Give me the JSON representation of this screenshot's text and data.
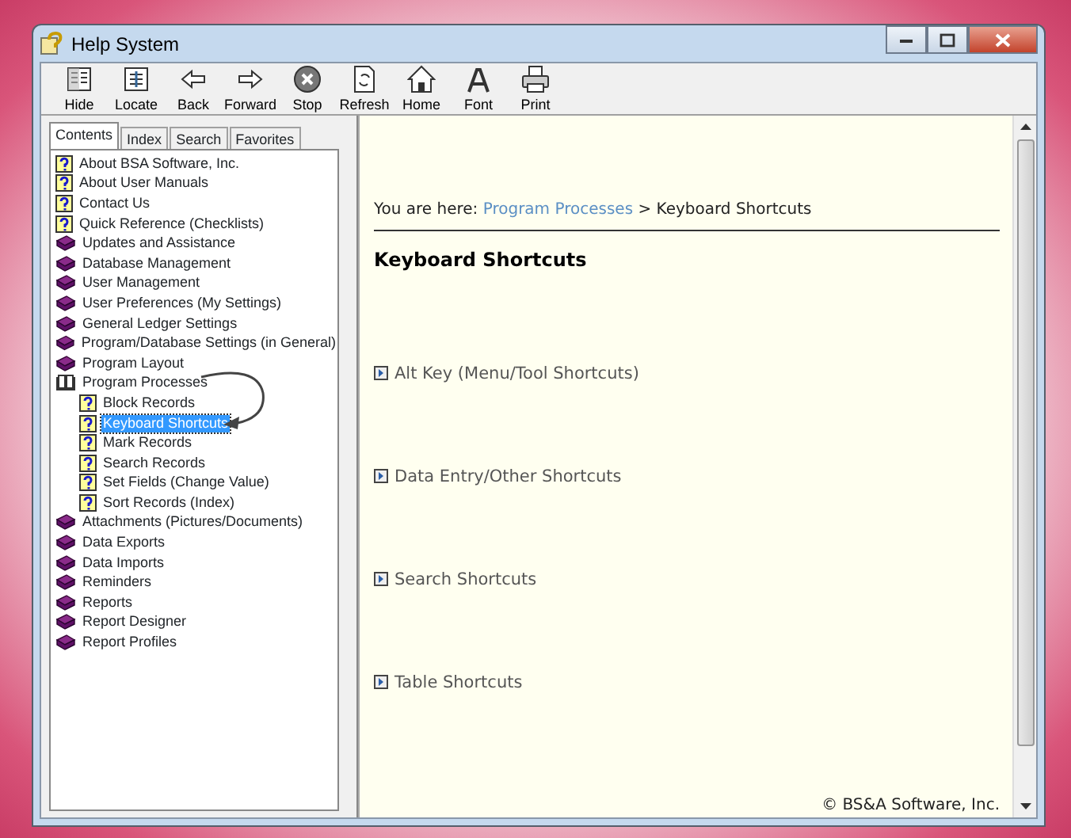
{
  "window": {
    "title": "Help System"
  },
  "toolbar": [
    {
      "label": "Hide",
      "kind": "hide"
    },
    {
      "label": "Locate",
      "kind": "locate"
    },
    {
      "label": "Back",
      "kind": "back"
    },
    {
      "label": "Forward",
      "kind": "forward"
    },
    {
      "label": "Stop",
      "kind": "stop"
    },
    {
      "label": "Refresh",
      "kind": "refresh"
    },
    {
      "label": "Home",
      "kind": "home"
    },
    {
      "label": "Font",
      "kind": "font"
    },
    {
      "label": "Print",
      "kind": "print"
    }
  ],
  "tabs": [
    {
      "label": "Contents",
      "selected": true
    },
    {
      "label": "Index",
      "selected": false
    },
    {
      "label": "Search",
      "selected": false
    },
    {
      "label": "Favorites",
      "selected": false
    }
  ],
  "tree": [
    {
      "label": "About BSA Software, Inc.",
      "kind": "page",
      "selected": false
    },
    {
      "label": "About User Manuals",
      "kind": "page",
      "selected": false
    },
    {
      "label": "Contact Us",
      "kind": "page",
      "selected": false
    },
    {
      "label": "Quick Reference (Checklists)",
      "kind": "page",
      "selected": false
    },
    {
      "label": "Updates and Assistance",
      "kind": "book",
      "expanded": false,
      "selected": false
    },
    {
      "label": "Database Management",
      "kind": "book",
      "expanded": false,
      "selected": false
    },
    {
      "label": "User Management",
      "kind": "book",
      "expanded": false,
      "selected": false
    },
    {
      "label": "User Preferences (My Settings)",
      "kind": "book",
      "expanded": false,
      "selected": false
    },
    {
      "label": "General Ledger Settings",
      "kind": "book",
      "expanded": false,
      "selected": false
    },
    {
      "label": "Program/Database Settings (in General)",
      "kind": "book",
      "expanded": false,
      "selected": false
    },
    {
      "label": "Program Layout",
      "kind": "book",
      "expanded": false,
      "selected": false
    },
    {
      "label": "Program Processes",
      "kind": "book",
      "expanded": true,
      "selected": false,
      "children": [
        {
          "label": "Block Records",
          "kind": "page",
          "selected": false
        },
        {
          "label": "Keyboard Shortcuts",
          "kind": "page",
          "selected": true
        },
        {
          "label": "Mark Records",
          "kind": "page",
          "selected": false
        },
        {
          "label": "Search Records",
          "kind": "page",
          "selected": false
        },
        {
          "label": "Set Fields (Change Value)",
          "kind": "page",
          "selected": false
        },
        {
          "label": "Sort Records (Index)",
          "kind": "page",
          "selected": false
        }
      ]
    },
    {
      "label": "Attachments (Pictures/Documents)",
      "kind": "book",
      "expanded": false,
      "selected": false
    },
    {
      "label": "Data Exports",
      "kind": "book",
      "expanded": false,
      "selected": false
    },
    {
      "label": "Data Imports",
      "kind": "book",
      "expanded": false,
      "selected": false
    },
    {
      "label": "Reminders",
      "kind": "book",
      "expanded": false,
      "selected": false
    },
    {
      "label": "Reports",
      "kind": "book",
      "expanded": false,
      "selected": false
    },
    {
      "label": "Report Designer",
      "kind": "book",
      "expanded": false,
      "selected": false
    },
    {
      "label": "Report Profiles",
      "kind": "book",
      "expanded": false,
      "selected": false
    }
  ],
  "content": {
    "breadcrumb": {
      "prefix": "You are here:",
      "link": "Program Processes",
      "separator": ">",
      "current": "Keyboard Shortcuts"
    },
    "heading": "Keyboard Shortcuts",
    "sections": [
      "Alt Key (Menu/Tool Shortcuts)",
      "Data Entry/Other Shortcuts",
      "Search Shortcuts",
      "Table Shortcuts"
    ],
    "footer": "© BS&A Software, Inc."
  }
}
